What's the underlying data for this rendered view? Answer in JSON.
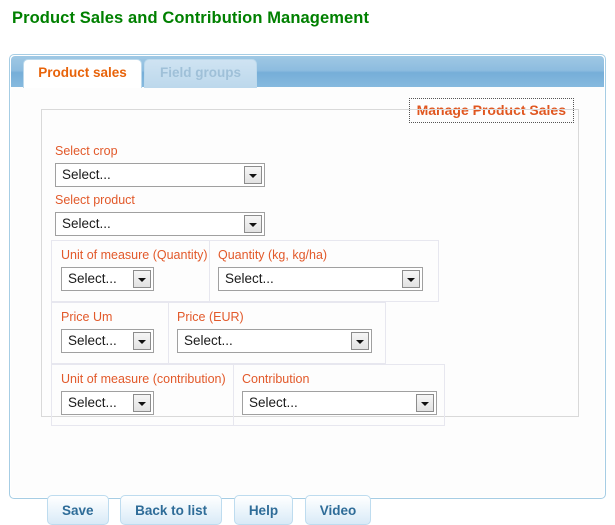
{
  "page": {
    "title": "Product Sales and Contribution Management",
    "title_color": "#008000"
  },
  "tabs": {
    "items": [
      {
        "label": "Product sales",
        "active": true
      },
      {
        "label": "Field groups",
        "active": false
      }
    ],
    "active_color": "#e8630a",
    "inactive_color": "#9fc0d8"
  },
  "section": {
    "heading": "Manage Product Sales",
    "heading_color": "#e0561f"
  },
  "form": {
    "placeholder_value": "Select...",
    "label_color": "#e2592a",
    "fields": [
      {
        "label": "Select crop",
        "value": "Select..."
      },
      {
        "label": "Select product",
        "value": "Select..."
      },
      {
        "label": "Unit of measure (Quantity)",
        "value": "Select..."
      },
      {
        "label": "Quantity (kg, kg/ha)",
        "value": "Select..."
      },
      {
        "label": "Price Um",
        "value": "Select..."
      },
      {
        "label": "Price (EUR)",
        "value": "Select..."
      },
      {
        "label": "Unit of measure (contribution)",
        "value": "Select..."
      },
      {
        "label": "Contribution",
        "value": "Select..."
      }
    ]
  },
  "buttons": [
    {
      "label": "Save"
    },
    {
      "label": "Back to list"
    },
    {
      "label": "Help"
    },
    {
      "label": "Video"
    }
  ]
}
